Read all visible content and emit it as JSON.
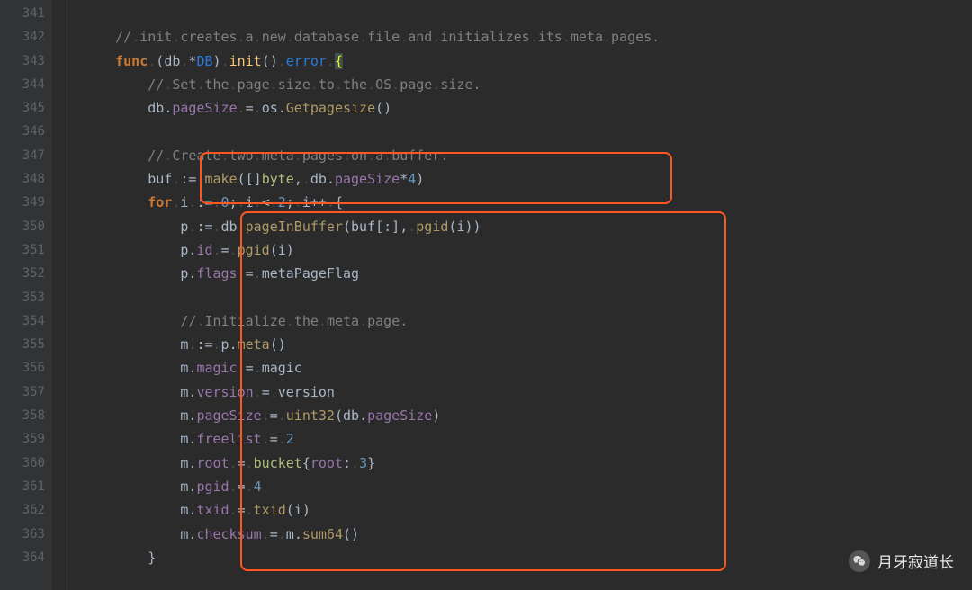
{
  "gutter": {
    "start": 341,
    "end": 364
  },
  "lines": [
    [
      {
        "c": "builtin",
        "t": "    "
      }
    ],
    [
      {
        "c": "ident",
        "t": "    "
      },
      {
        "c": "comment",
        "t": "//"
      },
      {
        "c": "ws",
        "t": "."
      },
      {
        "c": "comment",
        "t": "init"
      },
      {
        "c": "ws",
        "t": "."
      },
      {
        "c": "comment",
        "t": "creates"
      },
      {
        "c": "ws",
        "t": "."
      },
      {
        "c": "comment",
        "t": "a"
      },
      {
        "c": "ws",
        "t": "."
      },
      {
        "c": "comment",
        "t": "new"
      },
      {
        "c": "ws",
        "t": "."
      },
      {
        "c": "comment",
        "t": "database"
      },
      {
        "c": "ws",
        "t": "."
      },
      {
        "c": "comment",
        "t": "file"
      },
      {
        "c": "ws",
        "t": "."
      },
      {
        "c": "comment",
        "t": "and"
      },
      {
        "c": "ws",
        "t": "."
      },
      {
        "c": "comment",
        "t": "initializes"
      },
      {
        "c": "ws",
        "t": "."
      },
      {
        "c": "comment",
        "t": "its"
      },
      {
        "c": "ws",
        "t": "."
      },
      {
        "c": "comment",
        "t": "meta"
      },
      {
        "c": "ws",
        "t": "."
      },
      {
        "c": "comment",
        "t": "pages."
      }
    ],
    [
      {
        "c": "ident",
        "t": "    "
      },
      {
        "c": "keyword",
        "t": "func"
      },
      {
        "c": "ws",
        "t": "."
      },
      {
        "c": "paren",
        "t": "("
      },
      {
        "c": "ident",
        "t": "db"
      },
      {
        "c": "ws",
        "t": "."
      },
      {
        "c": "op",
        "t": "*"
      },
      {
        "c": "struct",
        "t": "DB"
      },
      {
        "c": "paren",
        "t": ")"
      },
      {
        "c": "ws",
        "t": "."
      },
      {
        "c": "funcdef",
        "t": "init"
      },
      {
        "c": "paren",
        "t": "()"
      },
      {
        "c": "ws",
        "t": "."
      },
      {
        "c": "struct",
        "t": "error"
      },
      {
        "c": "ws",
        "t": "."
      },
      {
        "c": "bracematch",
        "t": "{"
      }
    ],
    [
      {
        "c": "ident",
        "t": "        "
      },
      {
        "c": "comment",
        "t": "//"
      },
      {
        "c": "ws",
        "t": "."
      },
      {
        "c": "comment",
        "t": "Set"
      },
      {
        "c": "ws",
        "t": "."
      },
      {
        "c": "comment",
        "t": "the"
      },
      {
        "c": "ws",
        "t": "."
      },
      {
        "c": "comment",
        "t": "page"
      },
      {
        "c": "ws",
        "t": "."
      },
      {
        "c": "comment",
        "t": "size"
      },
      {
        "c": "ws",
        "t": "."
      },
      {
        "c": "comment",
        "t": "to"
      },
      {
        "c": "ws",
        "t": "."
      },
      {
        "c": "comment",
        "t": "the"
      },
      {
        "c": "ws",
        "t": "."
      },
      {
        "c": "comment",
        "t": "OS"
      },
      {
        "c": "ws",
        "t": "."
      },
      {
        "c": "comment",
        "t": "page"
      },
      {
        "c": "ws",
        "t": "."
      },
      {
        "c": "comment",
        "t": "size."
      }
    ],
    [
      {
        "c": "ident",
        "t": "        "
      },
      {
        "c": "ident",
        "t": "db"
      },
      {
        "c": "op",
        "t": "."
      },
      {
        "c": "field",
        "t": "pageSize"
      },
      {
        "c": "ws",
        "t": "."
      },
      {
        "c": "op",
        "t": "="
      },
      {
        "c": "ws",
        "t": "."
      },
      {
        "c": "ident",
        "t": "os"
      },
      {
        "c": "op",
        "t": "."
      },
      {
        "c": "func",
        "t": "Getpagesize"
      },
      {
        "c": "paren",
        "t": "()"
      }
    ],
    [
      {
        "c": "ident",
        "t": ""
      }
    ],
    [
      {
        "c": "ident",
        "t": "        "
      },
      {
        "c": "comment",
        "t": "//"
      },
      {
        "c": "ws",
        "t": "."
      },
      {
        "c": "comment",
        "t": "Create"
      },
      {
        "c": "ws",
        "t": "."
      },
      {
        "c": "comment",
        "t": "two"
      },
      {
        "c": "ws",
        "t": "."
      },
      {
        "c": "comment",
        "t": "meta"
      },
      {
        "c": "ws",
        "t": "."
      },
      {
        "c": "comment",
        "t": "pages"
      },
      {
        "c": "ws",
        "t": "."
      },
      {
        "c": "comment",
        "t": "on"
      },
      {
        "c": "ws",
        "t": "."
      },
      {
        "c": "comment",
        "t": "a"
      },
      {
        "c": "ws",
        "t": "."
      },
      {
        "c": "comment",
        "t": "buffer."
      }
    ],
    [
      {
        "c": "ident",
        "t": "        "
      },
      {
        "c": "ident",
        "t": "buf"
      },
      {
        "c": "ws",
        "t": "."
      },
      {
        "c": "op",
        "t": ":="
      },
      {
        "c": "ws",
        "t": "."
      },
      {
        "c": "func",
        "t": "make"
      },
      {
        "c": "paren",
        "t": "([]"
      },
      {
        "c": "type",
        "t": "byte"
      },
      {
        "c": "paren",
        "t": ","
      },
      {
        "c": "ws",
        "t": "."
      },
      {
        "c": "ident",
        "t": "db"
      },
      {
        "c": "op",
        "t": "."
      },
      {
        "c": "field",
        "t": "pageSize"
      },
      {
        "c": "op",
        "t": "*"
      },
      {
        "c": "num",
        "t": "4"
      },
      {
        "c": "paren",
        "t": ")"
      }
    ],
    [
      {
        "c": "ident",
        "t": "        "
      },
      {
        "c": "keyword",
        "t": "for"
      },
      {
        "c": "ws",
        "t": "."
      },
      {
        "c": "ident",
        "t": "i"
      },
      {
        "c": "ws",
        "t": "."
      },
      {
        "c": "op",
        "t": ":="
      },
      {
        "c": "ws",
        "t": "."
      },
      {
        "c": "num",
        "t": "0"
      },
      {
        "c": "op",
        "t": ";"
      },
      {
        "c": "ws",
        "t": "."
      },
      {
        "c": "ident",
        "t": "i"
      },
      {
        "c": "ws",
        "t": "."
      },
      {
        "c": "op",
        "t": "<"
      },
      {
        "c": "ws",
        "t": "."
      },
      {
        "c": "num",
        "t": "2"
      },
      {
        "c": "op",
        "t": ";"
      },
      {
        "c": "ws",
        "t": "."
      },
      {
        "c": "ident",
        "t": "i"
      },
      {
        "c": "op",
        "t": "++"
      },
      {
        "c": "ws",
        "t": "."
      },
      {
        "c": "op",
        "t": "{"
      }
    ],
    [
      {
        "c": "ident",
        "t": "            "
      },
      {
        "c": "ident",
        "t": "p"
      },
      {
        "c": "ws",
        "t": "."
      },
      {
        "c": "op",
        "t": ":="
      },
      {
        "c": "ws",
        "t": "."
      },
      {
        "c": "ident",
        "t": "db"
      },
      {
        "c": "op",
        "t": "."
      },
      {
        "c": "func",
        "t": "pageInBuffer"
      },
      {
        "c": "paren",
        "t": "("
      },
      {
        "c": "ident",
        "t": "buf"
      },
      {
        "c": "paren",
        "t": "[:],"
      },
      {
        "c": "ws",
        "t": "."
      },
      {
        "c": "func",
        "t": "pgid"
      },
      {
        "c": "paren",
        "t": "("
      },
      {
        "c": "ident",
        "t": "i"
      },
      {
        "c": "paren",
        "t": "))"
      }
    ],
    [
      {
        "c": "ident",
        "t": "            "
      },
      {
        "c": "ident",
        "t": "p"
      },
      {
        "c": "op",
        "t": "."
      },
      {
        "c": "field",
        "t": "id"
      },
      {
        "c": "ws",
        "t": "."
      },
      {
        "c": "op",
        "t": "="
      },
      {
        "c": "ws",
        "t": "."
      },
      {
        "c": "func",
        "t": "pgid"
      },
      {
        "c": "paren",
        "t": "("
      },
      {
        "c": "ident",
        "t": "i"
      },
      {
        "c": "paren",
        "t": ")"
      }
    ],
    [
      {
        "c": "ident",
        "t": "            "
      },
      {
        "c": "ident",
        "t": "p"
      },
      {
        "c": "op",
        "t": "."
      },
      {
        "c": "field",
        "t": "flags"
      },
      {
        "c": "ws",
        "t": "."
      },
      {
        "c": "op",
        "t": "="
      },
      {
        "c": "ws",
        "t": "."
      },
      {
        "c": "ident",
        "t": "metaPageFlag"
      }
    ],
    [
      {
        "c": "ident",
        "t": ""
      }
    ],
    [
      {
        "c": "ident",
        "t": "            "
      },
      {
        "c": "comment",
        "t": "//"
      },
      {
        "c": "ws",
        "t": "."
      },
      {
        "c": "comment",
        "t": "Initialize"
      },
      {
        "c": "ws",
        "t": "."
      },
      {
        "c": "comment",
        "t": "the"
      },
      {
        "c": "ws",
        "t": "."
      },
      {
        "c": "comment",
        "t": "meta"
      },
      {
        "c": "ws",
        "t": "."
      },
      {
        "c": "comment",
        "t": "page."
      }
    ],
    [
      {
        "c": "ident",
        "t": "            "
      },
      {
        "c": "ident",
        "t": "m"
      },
      {
        "c": "ws",
        "t": "."
      },
      {
        "c": "op",
        "t": ":="
      },
      {
        "c": "ws",
        "t": "."
      },
      {
        "c": "ident",
        "t": "p"
      },
      {
        "c": "op",
        "t": "."
      },
      {
        "c": "func",
        "t": "meta"
      },
      {
        "c": "paren",
        "t": "()"
      }
    ],
    [
      {
        "c": "ident",
        "t": "            "
      },
      {
        "c": "ident",
        "t": "m"
      },
      {
        "c": "op",
        "t": "."
      },
      {
        "c": "field",
        "t": "magic"
      },
      {
        "c": "ws",
        "t": "."
      },
      {
        "c": "op",
        "t": "="
      },
      {
        "c": "ws",
        "t": "."
      },
      {
        "c": "ident",
        "t": "magic"
      }
    ],
    [
      {
        "c": "ident",
        "t": "            "
      },
      {
        "c": "ident",
        "t": "m"
      },
      {
        "c": "op",
        "t": "."
      },
      {
        "c": "field",
        "t": "version"
      },
      {
        "c": "ws",
        "t": "."
      },
      {
        "c": "op",
        "t": "="
      },
      {
        "c": "ws",
        "t": "."
      },
      {
        "c": "ident",
        "t": "version"
      }
    ],
    [
      {
        "c": "ident",
        "t": "            "
      },
      {
        "c": "ident",
        "t": "m"
      },
      {
        "c": "op",
        "t": "."
      },
      {
        "c": "field",
        "t": "pageSize"
      },
      {
        "c": "ws",
        "t": "."
      },
      {
        "c": "op",
        "t": "="
      },
      {
        "c": "ws",
        "t": "."
      },
      {
        "c": "func",
        "t": "uint32"
      },
      {
        "c": "paren",
        "t": "("
      },
      {
        "c": "ident",
        "t": "db"
      },
      {
        "c": "op",
        "t": "."
      },
      {
        "c": "field",
        "t": "pageSize"
      },
      {
        "c": "paren",
        "t": ")"
      }
    ],
    [
      {
        "c": "ident",
        "t": "            "
      },
      {
        "c": "ident",
        "t": "m"
      },
      {
        "c": "op",
        "t": "."
      },
      {
        "c": "field",
        "t": "freelist"
      },
      {
        "c": "ws",
        "t": "."
      },
      {
        "c": "op",
        "t": "="
      },
      {
        "c": "ws",
        "t": "."
      },
      {
        "c": "num",
        "t": "2"
      }
    ],
    [
      {
        "c": "ident",
        "t": "            "
      },
      {
        "c": "ident",
        "t": "m"
      },
      {
        "c": "op",
        "t": "."
      },
      {
        "c": "field",
        "t": "root"
      },
      {
        "c": "ws",
        "t": "."
      },
      {
        "c": "op",
        "t": "="
      },
      {
        "c": "ws",
        "t": "."
      },
      {
        "c": "type",
        "t": "bucket"
      },
      {
        "c": "paren",
        "t": "{"
      },
      {
        "c": "field",
        "t": "root"
      },
      {
        "c": "paren",
        "t": ":"
      },
      {
        "c": "ws",
        "t": "."
      },
      {
        "c": "num",
        "t": "3"
      },
      {
        "c": "paren",
        "t": "}"
      }
    ],
    [
      {
        "c": "ident",
        "t": "            "
      },
      {
        "c": "ident",
        "t": "m"
      },
      {
        "c": "op",
        "t": "."
      },
      {
        "c": "field",
        "t": "pgid"
      },
      {
        "c": "ws",
        "t": "."
      },
      {
        "c": "op",
        "t": "="
      },
      {
        "c": "ws",
        "t": "."
      },
      {
        "c": "num",
        "t": "4"
      }
    ],
    [
      {
        "c": "ident",
        "t": "            "
      },
      {
        "c": "ident",
        "t": "m"
      },
      {
        "c": "op",
        "t": "."
      },
      {
        "c": "field",
        "t": "txid"
      },
      {
        "c": "ws",
        "t": "."
      },
      {
        "c": "op",
        "t": "="
      },
      {
        "c": "ws",
        "t": "."
      },
      {
        "c": "func",
        "t": "txid"
      },
      {
        "c": "paren",
        "t": "("
      },
      {
        "c": "ident",
        "t": "i"
      },
      {
        "c": "paren",
        "t": ")"
      }
    ],
    [
      {
        "c": "ident",
        "t": "            "
      },
      {
        "c": "ident",
        "t": "m"
      },
      {
        "c": "op",
        "t": "."
      },
      {
        "c": "field",
        "t": "checksum"
      },
      {
        "c": "ws",
        "t": "."
      },
      {
        "c": "op",
        "t": "="
      },
      {
        "c": "ws",
        "t": "."
      },
      {
        "c": "ident",
        "t": "m"
      },
      {
        "c": "op",
        "t": "."
      },
      {
        "c": "func",
        "t": "sum64"
      },
      {
        "c": "paren",
        "t": "()"
      }
    ],
    [
      {
        "c": "ident",
        "t": "        "
      },
      {
        "c": "op",
        "t": "}"
      }
    ]
  ],
  "watermark": {
    "text": "月牙寂道长"
  },
  "token_class_map": {
    "comment": "tok-comment",
    "keyword": "tok-keyword",
    "struct": "tok-struct",
    "funcdef": "tok-funcdef",
    "builtin": "tok-builtin",
    "ident": "tok-ident",
    "field": "tok-field",
    "func": "tok-func",
    "type": "tok-type",
    "num": "tok-num",
    "op": "tok-op",
    "bracematch": "tok-bracematch",
    "paren": "tok-paren",
    "ws": "ws-dot"
  }
}
